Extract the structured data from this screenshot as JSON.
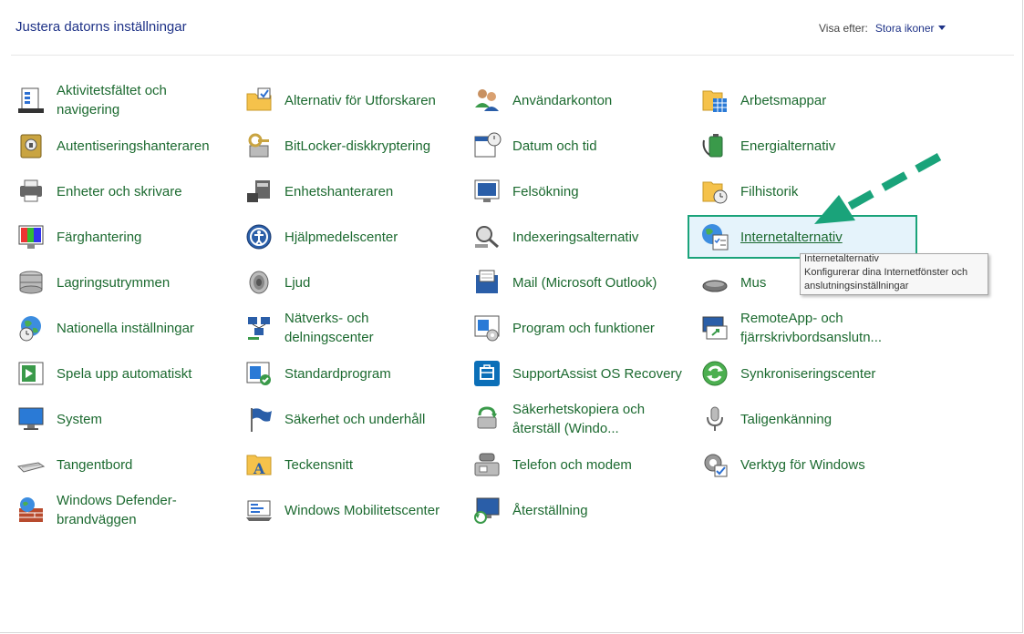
{
  "header": {
    "title": "Justera datorns inställningar",
    "view_by_label": "Visa efter:",
    "view_by_value": "Stora ikoner"
  },
  "columns": [
    [
      {
        "label": "Aktivitetsfältet och navigering",
        "icon": "taskbar-icon"
      },
      {
        "label": "Autentiseringshanteraren",
        "icon": "credential-manager-icon"
      },
      {
        "label": "Enheter och skrivare",
        "icon": "devices-printers-icon"
      },
      {
        "label": "Färghantering",
        "icon": "color-management-icon"
      },
      {
        "label": "Lagringsutrymmen",
        "icon": "storage-spaces-icon"
      },
      {
        "label": "Nationella inställningar",
        "icon": "region-icon"
      },
      {
        "label": "Spela upp automatiskt",
        "icon": "autoplay-icon"
      },
      {
        "label": "System",
        "icon": "system-icon"
      },
      {
        "label": "Tangentbord",
        "icon": "keyboard-icon"
      },
      {
        "label": "Windows Defender-brandväggen",
        "icon": "firewall-icon"
      }
    ],
    [
      {
        "label": "Alternativ för Utforskaren",
        "icon": "folder-options-icon"
      },
      {
        "label": "BitLocker-diskkryptering",
        "icon": "bitlocker-icon"
      },
      {
        "label": "Enhetshanteraren",
        "icon": "device-manager-icon"
      },
      {
        "label": "Hjälpmedelscenter",
        "icon": "ease-of-access-icon"
      },
      {
        "label": "Ljud",
        "icon": "sound-icon"
      },
      {
        "label": "Nätverks- och delningscenter",
        "icon": "network-sharing-icon"
      },
      {
        "label": "Standardprogram",
        "icon": "default-programs-icon"
      },
      {
        "label": "Säkerhet och underhåll",
        "icon": "security-maintenance-icon"
      },
      {
        "label": "Teckensnitt",
        "icon": "fonts-icon"
      },
      {
        "label": "Windows Mobilitetscenter",
        "icon": "mobility-center-icon"
      }
    ],
    [
      {
        "label": "Användarkonton",
        "icon": "user-accounts-icon"
      },
      {
        "label": "Datum och tid",
        "icon": "date-time-icon"
      },
      {
        "label": "Felsökning",
        "icon": "troubleshooting-icon"
      },
      {
        "label": "Indexeringsalternativ",
        "icon": "indexing-icon"
      },
      {
        "label": "Mail (Microsoft Outlook)",
        "icon": "mail-icon"
      },
      {
        "label": "Program och funktioner",
        "icon": "programs-features-icon"
      },
      {
        "label": "SupportAssist OS Recovery",
        "icon": "supportassist-icon"
      },
      {
        "label": "Säkerhetskopiera och återställ (Windo...",
        "icon": "backup-restore-icon"
      },
      {
        "label": "Telefon och modem",
        "icon": "phone-modem-icon"
      },
      {
        "label": "Återställning",
        "icon": "recovery-icon"
      }
    ],
    [
      {
        "label": "Arbetsmappar",
        "icon": "work-folders-icon"
      },
      {
        "label": "Energialternativ",
        "icon": "power-options-icon"
      },
      {
        "label": "Filhistorik",
        "icon": "file-history-icon"
      },
      {
        "label": "Internetalternativ",
        "icon": "internet-options-icon"
      },
      {
        "label": "Mus",
        "icon": "mouse-icon"
      },
      {
        "label": "RemoteApp- och fjärrskrivbordsanslutn...",
        "icon": "remoteapp-icon"
      },
      {
        "label": "Synkroniseringscenter",
        "icon": "sync-center-icon"
      },
      {
        "label": "Taligenkänning",
        "icon": "speech-recognition-icon"
      },
      {
        "label": "Verktyg för Windows",
        "icon": "windows-tools-icon"
      }
    ]
  ],
  "tooltip": {
    "title": "Internetalternativ",
    "description": "Konfigurerar dina Internetfönster och anslutningsinställningar"
  },
  "colors": {
    "link_green": "#1c6a30",
    "title_blue": "#1e3287",
    "highlight_border": "#1aa37a",
    "highlight_bg": "#e5f3fb",
    "arrow": "#1aa37a"
  }
}
